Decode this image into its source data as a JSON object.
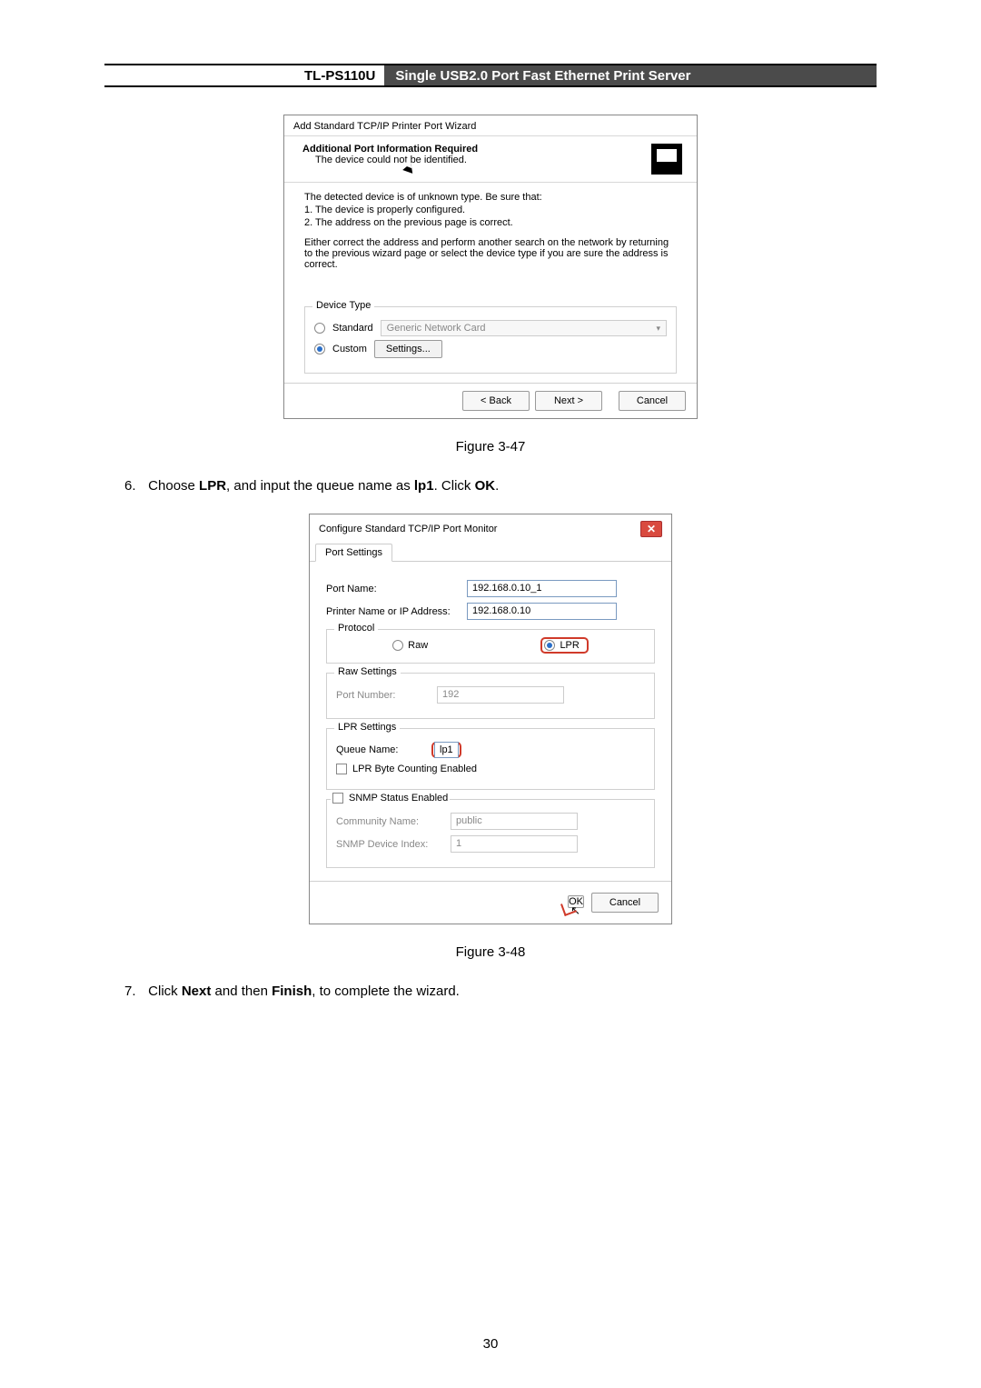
{
  "header": {
    "model": "TL-PS110U",
    "desc": "Single USB2.0 Port Fast Ethernet Print Server"
  },
  "win1": {
    "title": "Add Standard TCP/IP Printer Port Wizard",
    "hdr_bold": "Additional Port Information Required",
    "hdr_sub": "The device could not be identified.",
    "line1": "The detected device is of unknown type.  Be sure that:",
    "line2": "1. The device is properly configured.",
    "line3": "2.  The address on the previous page is correct.",
    "para2": "Either correct the address and perform another search on the network by returning to the previous wizard page or select the device type if you are sure the address is correct.",
    "device_type": "Device Type",
    "standard": "Standard",
    "generic": "Generic Network Card",
    "custom": "Custom",
    "settings": "Settings...",
    "back": "< Back",
    "next": "Next >",
    "cancel": "Cancel"
  },
  "fig47": "Figure 3-47",
  "step6": {
    "num": "6.",
    "pre": "Choose ",
    "b1": "LPR",
    "mid": ", and input the queue name as ",
    "b2": "lp1",
    "mid2": ". Click ",
    "b3": "OK",
    "end": "."
  },
  "win2": {
    "title": "Configure Standard TCP/IP Port Monitor",
    "tab": "Port Settings",
    "port_name_l": "Port Name:",
    "port_name_v": "192.168.0.10_1",
    "printer_l": "Printer Name or IP Address:",
    "printer_v": "192.168.0.10",
    "protocol": "Protocol",
    "raw": "Raw",
    "lpr": "LPR",
    "raw_settings": "Raw Settings",
    "port_num_l": "Port Number:",
    "port_num_v": "192",
    "lpr_settings": "LPR Settings",
    "queue_l": "Queue Name:",
    "queue_v": "lp1",
    "lpr_byte": "LPR Byte Counting Enabled",
    "snmp_status": "SNMP Status Enabled",
    "community_l": "Community Name:",
    "community_v": "public",
    "snmp_idx_l": "SNMP Device Index:",
    "snmp_idx_v": "1",
    "ok": "OK",
    "cancel": "Cancel"
  },
  "fig48": "Figure 3-48",
  "step7": {
    "num": "7.",
    "pre": "Click ",
    "b1": "Next",
    "mid": " and then ",
    "b2": "Finish",
    "end": ", to complete the wizard."
  },
  "page_number": "30"
}
